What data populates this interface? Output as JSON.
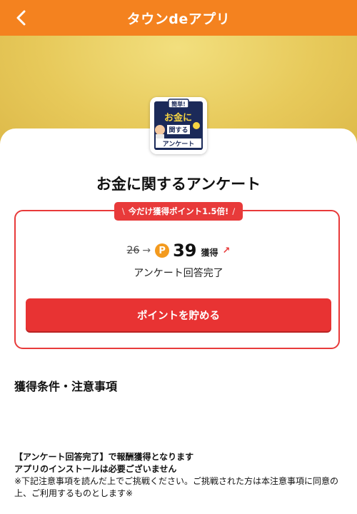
{
  "header": {
    "title": "タウンdeアプリ",
    "back_icon": "chevron-left-icon"
  },
  "colors": {
    "header": "#f4821f",
    "accent_red": "#e83a3a",
    "hero_gold": "#e7c95a",
    "coin": "#f39a1e",
    "thumb_navy": "#1b2a59"
  },
  "thumbnail": {
    "badge": "簡単!",
    "line1": "お金に",
    "line2": "関する",
    "line3": "アンケート"
  },
  "survey": {
    "title": "お金に関するアンケート"
  },
  "reward": {
    "promo": "今だけ獲得ポイント1.5倍!",
    "old_points": "26",
    "arrow": "→",
    "coin_symbol": "P",
    "new_points": "39",
    "get_label": "獲得",
    "up_arrow": "↗",
    "condition": "アンケート回答完了",
    "button_label": "ポイントを貯める"
  },
  "conditions": {
    "title": "獲得条件・注意事項",
    "notes": [
      "【アンケート回答完了】で報酬獲得となります",
      "アプリのインストールは必要ございません",
      "※下記注意事項を読んだ上でご挑戦ください。ご挑戦された方は本注意事項に同意の",
      "上、ご利用するものとします※"
    ]
  }
}
